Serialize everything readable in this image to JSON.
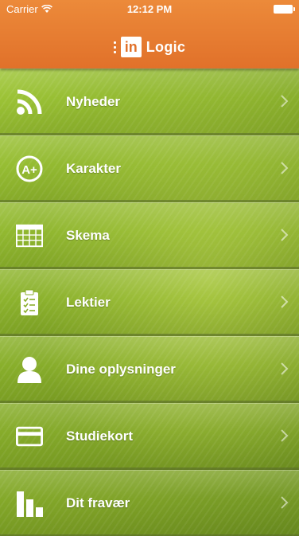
{
  "status_bar": {
    "carrier": "Carrier",
    "time": "12:12 PM"
  },
  "header": {
    "logo_box": "in",
    "logo_word": "Logic"
  },
  "colors": {
    "header": "#e1712a",
    "menu_green": "#86ad27"
  },
  "menu": {
    "items": [
      {
        "label": "Nyheder",
        "icon": "rss-icon"
      },
      {
        "label": "Karakter",
        "icon": "grade-icon"
      },
      {
        "label": "Skema",
        "icon": "schedule-grid-icon"
      },
      {
        "label": "Lektier",
        "icon": "clipboard-icon"
      },
      {
        "label": "Dine oplysninger",
        "icon": "user-icon"
      },
      {
        "label": "Studiekort",
        "icon": "card-icon"
      },
      {
        "label": "Dit fravær",
        "icon": "bar-chart-icon"
      }
    ]
  }
}
